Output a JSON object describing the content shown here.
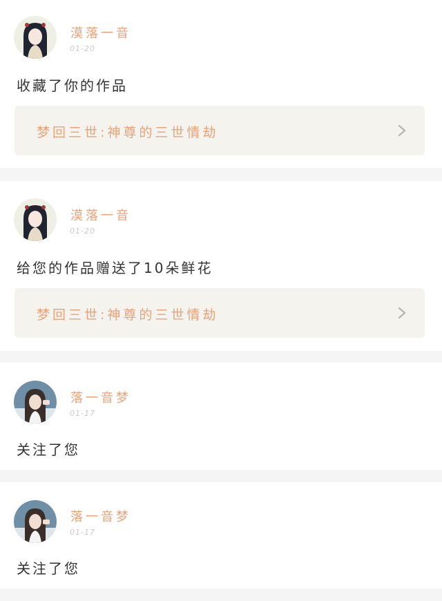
{
  "notifications": [
    {
      "username": "漠落一音",
      "time": "01-20",
      "message": "收藏了你的作品",
      "avatar_icon": "anime-girl-avatar",
      "work_title": "梦回三世:神尊的三世情劫"
    },
    {
      "username": "漠落一音",
      "time": "01-20",
      "message": "给您的作品赠送了10朵鲜花",
      "avatar_icon": "anime-girl-avatar",
      "work_title": "梦回三世:神尊的三世情劫"
    },
    {
      "username": "落一音梦",
      "time": "01-17",
      "message": "关注了您",
      "avatar_icon": "photo-girl-avatar"
    },
    {
      "username": "落一音梦",
      "time": "01-17",
      "message": "关注了您",
      "avatar_icon": "photo-girl-avatar"
    }
  ],
  "colors": {
    "accent": "#e8a27a",
    "card_background": "#ffffff",
    "page_background": "#f5f5f5",
    "link_background": "#f4f3ee",
    "text": "#333333",
    "muted": "#c9c9c9"
  }
}
